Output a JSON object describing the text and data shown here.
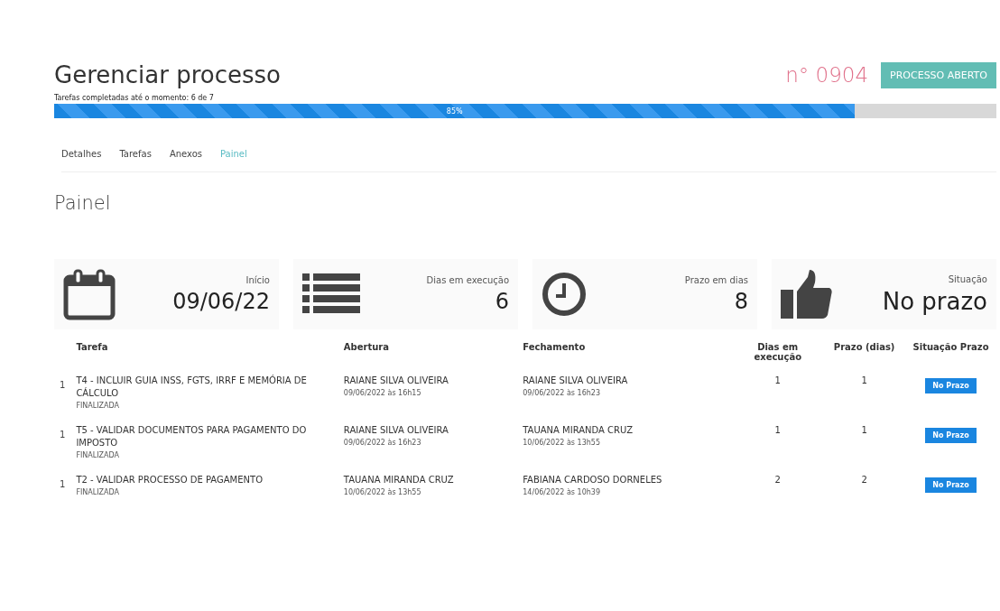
{
  "header": {
    "title": "Gerenciar processo",
    "number": "n° 0904",
    "status_badge": "PROCESSO ABERTO"
  },
  "progress": {
    "label": "Tarefas completadas até o momento: 6 de 7",
    "reading": "85%",
    "level": 0.85
  },
  "tabs": [
    {
      "label": "Detalhes",
      "selected": false
    },
    {
      "label": "Tarefas",
      "selected": false
    },
    {
      "label": "Anexos",
      "selected": false
    },
    {
      "label": "Painel",
      "selected": true
    }
  ],
  "section_title": "Painel",
  "stats": [
    {
      "kind": "calendar",
      "label": "Início",
      "value": "09/06/22"
    },
    {
      "kind": "list",
      "label": "Dias em execução",
      "value": "6"
    },
    {
      "kind": "clock",
      "label": "Prazo em dias",
      "value": "8"
    },
    {
      "kind": "thumb",
      "label": "Situação",
      "value": "No prazo"
    }
  ],
  "table": {
    "columns": [
      "Tarefa",
      "Abertura",
      "Fechamento",
      "Dias em execução",
      "Prazo (dias)",
      "Situação Prazo"
    ],
    "rows": [
      {
        "index": "1",
        "task": "T4 - INCLUIR GUIA INSS, FGTS, IRRF E MEMÓRIA DE CÁLCULO",
        "status": "FINALIZADA",
        "opened_by": "RAIANE SILVA OLIVEIRA",
        "opened_at": "09/06/2022 às 16h15",
        "closed_by": "RAIANE SILVA OLIVEIRA",
        "closed_at": "09/06/2022 às 16h23",
        "days": "1",
        "deadline": "1",
        "situation": "No Prazo"
      },
      {
        "index": "1",
        "task": "T5 - VALIDAR DOCUMENTOS PARA PAGAMENTO DO IMPOSTO",
        "status": "FINALIZADA",
        "opened_by": "RAIANE SILVA OLIVEIRA",
        "opened_at": "09/06/2022 às 16h23",
        "closed_by": "TAUANA MIRANDA CRUZ",
        "closed_at": "10/06/2022 às 13h55",
        "days": "1",
        "deadline": "1",
        "situation": "No Prazo"
      },
      {
        "index": "1",
        "task": "T2 - VALIDAR PROCESSO DE PAGAMENTO",
        "status": "FINALIZADA",
        "opened_by": "TAUANA MIRANDA CRUZ",
        "opened_at": "10/06/2022 às 13h55",
        "closed_by": "FABIANA CARDOSO DORNELES",
        "closed_at": "14/06/2022 às 10h39",
        "days": "2",
        "deadline": "2",
        "situation": "No Prazo"
      }
    ]
  }
}
